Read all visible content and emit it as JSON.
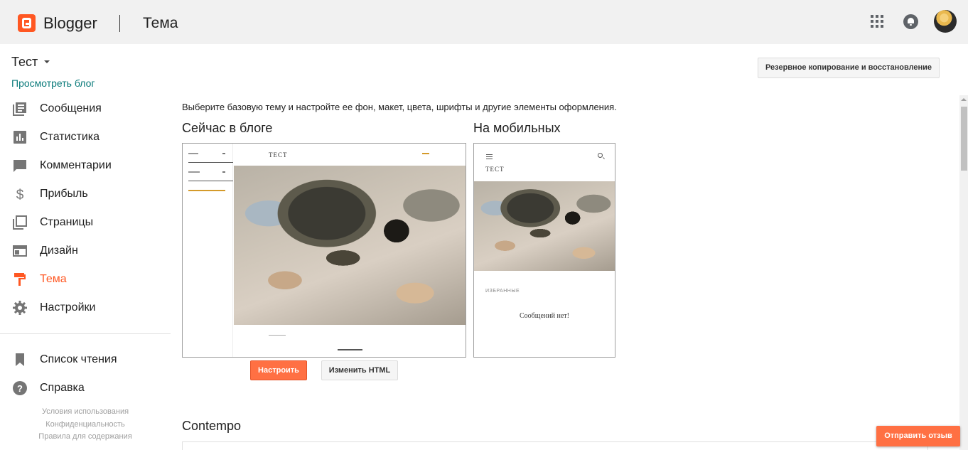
{
  "header": {
    "app_name": "Blogger",
    "section_title": "Тема"
  },
  "sidebar": {
    "blog_name": "Тест",
    "view_blog_link": "Просмотреть блог",
    "items": [
      {
        "label": "Сообщения",
        "icon": "posts-icon"
      },
      {
        "label": "Статистика",
        "icon": "stats-icon"
      },
      {
        "label": "Комментарии",
        "icon": "comments-icon"
      },
      {
        "label": "Прибыль",
        "icon": "dollar-icon"
      },
      {
        "label": "Страницы",
        "icon": "pages-icon"
      },
      {
        "label": "Дизайн",
        "icon": "layout-icon"
      },
      {
        "label": "Тема",
        "icon": "paint-roller-icon",
        "active": true
      },
      {
        "label": "Настройки",
        "icon": "gear-icon"
      }
    ],
    "secondary_items": [
      {
        "label": "Список чтения",
        "icon": "bookmark-icon"
      },
      {
        "label": "Справка",
        "icon": "help-icon"
      }
    ],
    "footer_links": [
      "Условия использования",
      "Конфиденциальность",
      "Правила для содержания"
    ]
  },
  "main": {
    "backup_button": "Резервное копирование и восстановление",
    "intro_text": "Выберите базовую тему и настройте ее фон, макет, цвета, шрифты и другие элементы оформления.",
    "current_title": "Сейчас в блоге",
    "mobile_title": "На мобильных",
    "desktop_preview": {
      "blog_title": "ТЕСТ"
    },
    "mobile_preview": {
      "blog_title": "ТЕСТ",
      "favorites_label": "ИЗБРАННЫЕ",
      "no_posts_text": "Сообщений нет!"
    },
    "customize_button": "Настроить",
    "edit_html_button": "Изменить HTML",
    "theme_section_title": "Contempo"
  },
  "feedback_button": "Отправить отзыв",
  "colors": {
    "accent": "#ff5722",
    "button_orange": "#ff7043",
    "link_teal": "#0a7a7a",
    "header_bg": "#f1f1f1"
  }
}
